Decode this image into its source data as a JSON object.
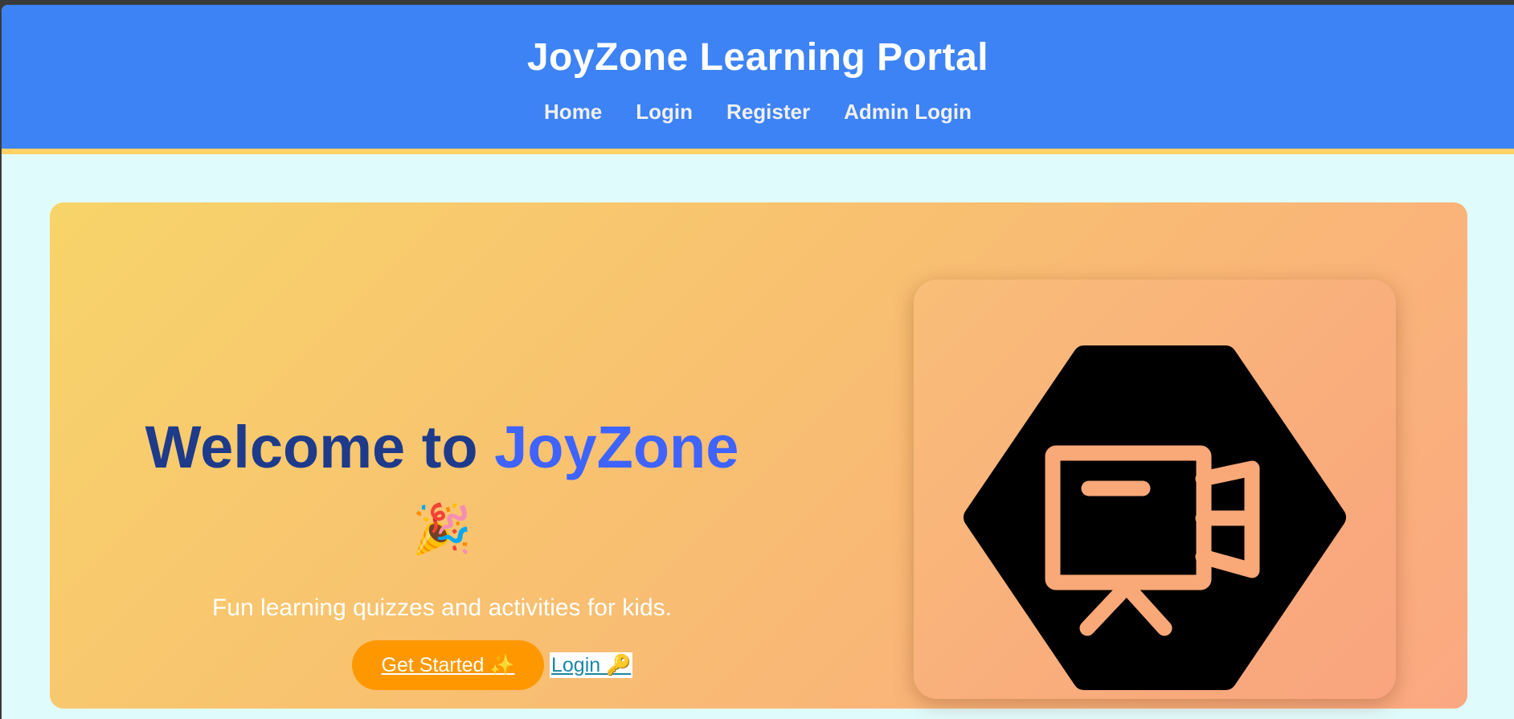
{
  "header": {
    "title": "JoyZone Learning Portal",
    "nav": [
      {
        "label": "Home"
      },
      {
        "label": "Login"
      },
      {
        "label": "Register"
      },
      {
        "label": "Admin Login"
      }
    ]
  },
  "hero": {
    "heading_prefix": "Welcome to ",
    "heading_brand": "JoyZone",
    "heading_emoji": "🎉",
    "subtitle": "Fun learning quizzes and activities for kids.",
    "get_started_label": "Get Started ✨",
    "login_label": "Login 🔑",
    "illustration_icon": "video-projector-hexagon-icon"
  },
  "colors": {
    "header_bg": "#3d83f5",
    "header_border": "#ffd166",
    "page_bg": "#e0fbfc",
    "heading": "#1e3a8a",
    "brand": "#3f63ff",
    "cta": "#ff9800",
    "link": "#1a86a8"
  }
}
